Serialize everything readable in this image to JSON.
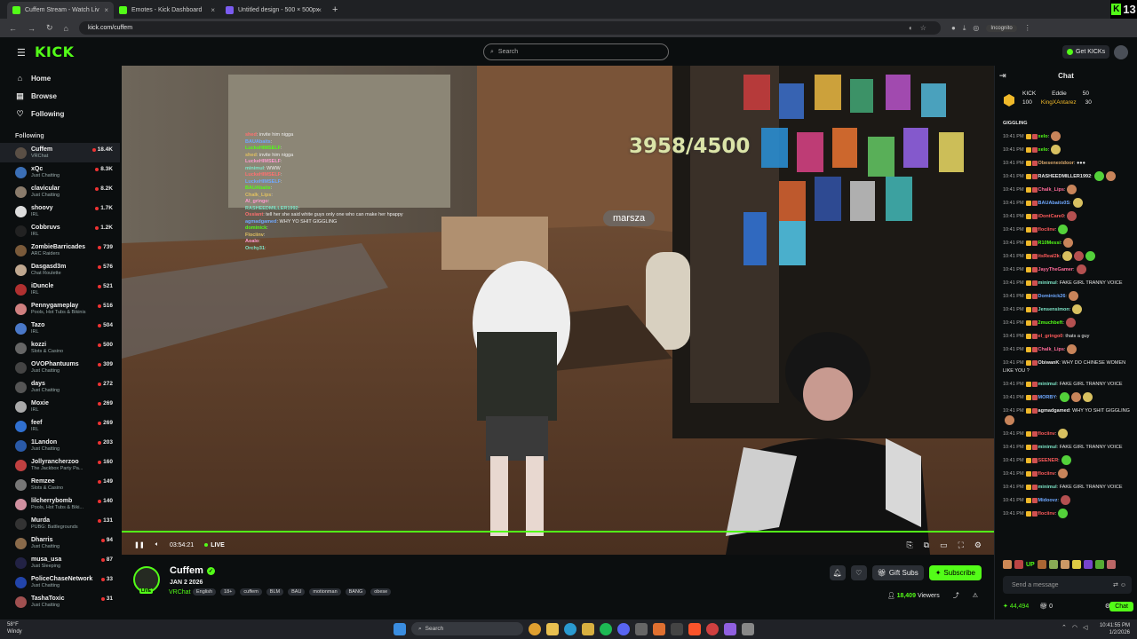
{
  "browser": {
    "tabs": [
      {
        "label": "Cuffem Stream - Watch Liv",
        "color": "#53fc18",
        "active": true
      },
      {
        "label": "Emotes - Kick Dashboard",
        "color": "#53fc18",
        "active": false
      },
      {
        "label": "Untitled design - 500 × 500px",
        "color": "#7b5cf0",
        "active": false
      }
    ],
    "new_tab": "+",
    "url": "kick.com/cuffem",
    "incognito": "Incognito",
    "corner_badge": "13"
  },
  "header": {
    "logo": "KICK",
    "search_placeholder": "Search",
    "get_kicks": "Get KICKs"
  },
  "sidebar": {
    "nav": [
      {
        "label": "Home",
        "icon": "home-icon",
        "glyph": "⌂"
      },
      {
        "label": "Browse",
        "icon": "browse-icon",
        "glyph": "▤"
      },
      {
        "label": "Following",
        "icon": "heart-icon",
        "glyph": "♡"
      }
    ],
    "following_title": "Following",
    "channels": [
      {
        "name": "Cuffem",
        "category": "VRChat",
        "viewers": "18.4K",
        "color": "#5a4f45"
      },
      {
        "name": "xQc",
        "category": "Just Chatting",
        "viewers": "8.3K",
        "color": "#3b6fb6"
      },
      {
        "name": "clavicular",
        "category": "Just Chatting",
        "viewers": "8.2K",
        "color": "#8a7b6b"
      },
      {
        "name": "shoovy",
        "category": "IRL",
        "viewers": "1.7K",
        "color": "#dddddd"
      },
      {
        "name": "Cobbruvs",
        "category": "IRL",
        "viewers": "1.2K",
        "color": "#222222"
      },
      {
        "name": "ZombieBarricades",
        "category": "ARC Raiders",
        "viewers": "739",
        "color": "#7a5a3a"
      },
      {
        "name": "Dasgasd3m",
        "category": "Chat Roulette",
        "viewers": "576",
        "color": "#c0a890"
      },
      {
        "name": "iDuncle",
        "category": "IRL",
        "viewers": "521",
        "color": "#b03030"
      },
      {
        "name": "Pennygameplay",
        "category": "Pools, Hot Tubs & Bikinis",
        "viewers": "516",
        "color": "#d08080"
      },
      {
        "name": "Tazo",
        "category": "IRL",
        "viewers": "504",
        "color": "#4a78c8"
      },
      {
        "name": "kozzi",
        "category": "Slots & Casino",
        "viewers": "500",
        "color": "#666666"
      },
      {
        "name": "OVOPhantuums",
        "category": "Just Chatting",
        "viewers": "309",
        "color": "#444444"
      },
      {
        "name": "days",
        "category": "Just Chatting",
        "viewers": "272",
        "color": "#555555"
      },
      {
        "name": "Moxie",
        "category": "IRL",
        "viewers": "269",
        "color": "#aaaaaa"
      },
      {
        "name": "feef",
        "category": "IRL",
        "viewers": "269",
        "color": "#3070d0"
      },
      {
        "name": "1Landon",
        "category": "Just Chatting",
        "viewers": "203",
        "color": "#2a5aa8"
      },
      {
        "name": "Jollyrancherzoo",
        "category": "The Jackbox Party Pa...",
        "viewers": "160",
        "color": "#c04040"
      },
      {
        "name": "Remzee",
        "category": "Slots & Casino",
        "viewers": "149",
        "color": "#777777"
      },
      {
        "name": "lilcherrybomb",
        "category": "Pools, Hot Tubs & Biki...",
        "viewers": "140",
        "color": "#d090a0"
      },
      {
        "name": "Murda",
        "category": "PUBG: Battlegrounds",
        "viewers": "131",
        "color": "#333333"
      },
      {
        "name": "Dharris",
        "category": "Just Chatting",
        "viewers": "94",
        "color": "#8a6a4a"
      },
      {
        "name": "musa_usa",
        "category": "Just Sleeping",
        "viewers": "87",
        "color": "#222244"
      },
      {
        "name": "PoliceChaseNetwork",
        "category": "Just Chatting",
        "viewers": "33",
        "color": "#2244aa"
      },
      {
        "name": "TashaToxic",
        "category": "Just Chatting",
        "viewers": "31",
        "color": "#a05050"
      }
    ]
  },
  "video": {
    "goal_text": "3958/4500",
    "nameplate": "marsza",
    "progress_fraction": 1.0,
    "elapsed": "03:54:21",
    "live_label": "LIVE",
    "overlay_chat": [
      {
        "u": "shed",
        "m": "invite him nigga"
      },
      {
        "u": "BAUAbaits",
        "m": ""
      },
      {
        "u": "LuckeHIMSELF",
        "m": ""
      },
      {
        "u": "shed",
        "m": "invite him nigga"
      },
      {
        "u": "LuckeHIMSELF",
        "m": ""
      },
      {
        "u": "minimul",
        "m": "WWW"
      },
      {
        "u": "LuckeHIMSELF",
        "m": ""
      },
      {
        "u": "LuckeHIMSELF",
        "m": ""
      },
      {
        "u": "BAUAbaits",
        "m": ""
      },
      {
        "u": "Chalk_Lips",
        "m": ""
      },
      {
        "u": "Al_gringo",
        "m": ""
      },
      {
        "u": "RASHEEDMILLER1992",
        "m": ""
      },
      {
        "u": "Ossiant",
        "m": "tell her she said white guys only one who can make her hpappy"
      },
      {
        "u": "agmadgamed",
        "m": "WHY YO SHIT GIGGLING"
      },
      {
        "u": "dominick",
        "m": ""
      },
      {
        "u": "Flociinv",
        "m": ""
      },
      {
        "u": "Aoalo",
        "m": ""
      },
      {
        "u": "Orchy31",
        "m": ""
      }
    ]
  },
  "streamer": {
    "name": "Cuffem",
    "date": "JAN 2 2026",
    "category": "VRChat",
    "tags": [
      "English",
      "18+",
      "cuffem",
      "BLM",
      "BAU",
      "motionman",
      "BANG",
      "obese"
    ],
    "gift_subs": "Gift Subs",
    "subscribe": "Subscribe",
    "viewers": "18,409",
    "viewers_label": "Viewers"
  },
  "chat": {
    "title": "Chat",
    "leaderboard": [
      {
        "name": "KICK",
        "value": "100"
      },
      {
        "name": "Eddie",
        "value": "50"
      },
      {
        "name": "KingXAntarez",
        "value": "30"
      }
    ],
    "messages": [
      {
        "t": "",
        "u": "GIGGLING",
        "c": "#e8e8e8",
        "m": "",
        "e": 0
      },
      {
        "t": "10:41 PM",
        "u": "xelo",
        "c": "#53fc18",
        "m": ":",
        "e": 1
      },
      {
        "t": "10:41 PM",
        "u": "xelo",
        "c": "#53fc18",
        "m": ":",
        "e": 1
      },
      {
        "t": "10:41 PM",
        "u": "Obesenextdoor",
        "c": "#d9a86c",
        "m": ": ●●●",
        "e": 0
      },
      {
        "t": "10:41 PM",
        "u": "RASHEEDMILLER1992",
        "c": "#e8e8e8",
        "m": ":",
        "e": 2
      },
      {
        "t": "10:41 PM",
        "u": "Chalk_Lips",
        "c": "#ff6b9a",
        "m": ":",
        "e": 1
      },
      {
        "t": "10:41 PM",
        "u": "BAUAbaits0S",
        "c": "#6fa8ff",
        "m": ":",
        "e": 1
      },
      {
        "t": "10:41 PM",
        "u": "iDontCare0",
        "c": "#ff5b5b",
        "m": ":",
        "e": 1
      },
      {
        "t": "10:41 PM",
        "u": "flociinv",
        "c": "#ff5b5b",
        "m": ":",
        "e": 1
      },
      {
        "t": "10:41 PM",
        "u": "R10Messi",
        "c": "#53fc18",
        "m": ":",
        "e": 1
      },
      {
        "t": "10:41 PM",
        "u": "itsReal2k",
        "c": "#ff5b5b",
        "m": ":",
        "e": 3
      },
      {
        "t": "10:41 PM",
        "u": "JayyTheGamer",
        "c": "#ff6b9a",
        "m": ":",
        "e": 1
      },
      {
        "t": "10:41 PM",
        "u": "minimul",
        "c": "#7ee6c8",
        "m": ": FAKE GIRL TRANNY VOICE",
        "e": 0,
        "multi": true
      },
      {
        "t": "10:41 PM",
        "u": "Dominick26",
        "c": "#6fa8ff",
        "m": ":",
        "e": 1
      },
      {
        "t": "10:41 PM",
        "u": "Jensensimon",
        "c": "#7ee6c8",
        "m": ":",
        "e": 1
      },
      {
        "t": "10:41 PM",
        "u": "2muchbeft",
        "c": "#53fc18",
        "m": ":",
        "e": 1
      },
      {
        "t": "10:41 PM",
        "u": "el_gringo0",
        "c": "#ff5b5b",
        "m": ": thats a guy",
        "e": 0
      },
      {
        "t": "10:41 PM",
        "u": "Chalk_Lips",
        "c": "#ff6b9a",
        "m": ":",
        "e": 1
      },
      {
        "t": "10:41 PM",
        "u": "ObiwanK",
        "c": "#e8e8e8",
        "m": ": WHY DO CHINESE WOMEN LIKE YOU ?",
        "e": 0,
        "multi": true
      },
      {
        "t": "10:41 PM",
        "u": "minimul",
        "c": "#7ee6c8",
        "m": ": FAKE GIRL TRANNY VOICE",
        "e": 0,
        "multi": true
      },
      {
        "t": "10:41 PM",
        "u": "MORBY",
        "c": "#6fa8ff",
        "m": ":",
        "e": 3
      },
      {
        "t": "10:41 PM",
        "u": "agmadgamed",
        "c": "#e8e8e8",
        "m": ": WHY YO SHIT GIGGLING",
        "e": 1,
        "multi": true
      },
      {
        "t": "10:41 PM",
        "u": "flociinv",
        "c": "#ff5b5b",
        "m": ":",
        "e": 1
      },
      {
        "t": "10:41 PM",
        "u": "minimul",
        "c": "#7ee6c8",
        "m": ": FAKE GIRL TRANNY VOICE",
        "e": 0,
        "multi": true
      },
      {
        "t": "10:41 PM",
        "u": "SEENER",
        "c": "#ff5b5b",
        "m": ":",
        "e": 1
      },
      {
        "t": "10:41 PM",
        "u": "flociinv",
        "c": "#ff5b5b",
        "m": ":",
        "e": 1
      },
      {
        "t": "10:41 PM",
        "u": "minimul",
        "c": "#7ee6c8",
        "m": ": FAKE GIRL TRANNY VOICE",
        "e": 0,
        "multi": true
      },
      {
        "t": "10:41 PM",
        "u": "Midoovz",
        "c": "#6fa8ff",
        "m": ":",
        "e": 1
      },
      {
        "t": "10:41 PM",
        "u": "flociinv",
        "c": "#ff5b5b",
        "m": ":",
        "e": 1
      }
    ],
    "emote_up": "UP",
    "send_placeholder": "Send a message",
    "kicks_balance": "44,494",
    "gift_count": "0",
    "chat_button": "Chat"
  },
  "taskbar": {
    "temp": "58°F",
    "weather": "Windy",
    "search": "Search",
    "time": "10:41:55 PM",
    "date": "1/2/2026"
  },
  "colors": {
    "accent": "#53fc18",
    "bg": "#0b0e0f",
    "panel": "#1e2126"
  }
}
